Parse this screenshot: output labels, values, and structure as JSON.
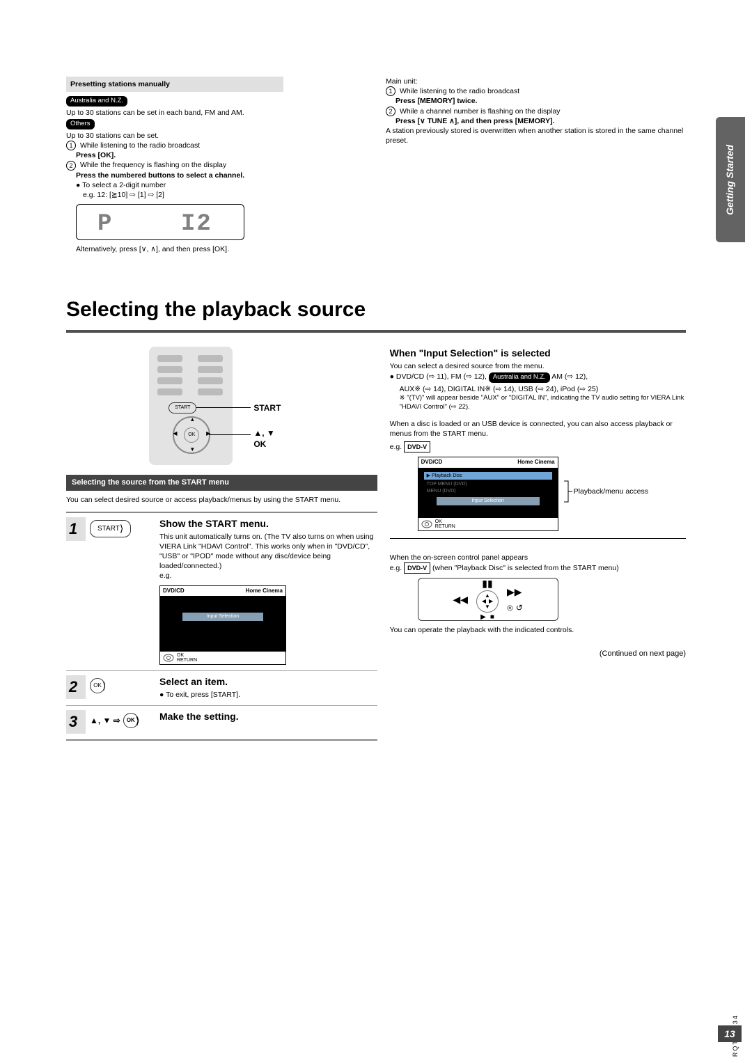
{
  "preset": {
    "title": "Presetting stations manually",
    "au_nz_tag": "Australia and N.Z.",
    "au_nz_text": "Up to 30 stations can be set in each band, FM and AM.",
    "others_tag": "Others",
    "others_text": "Up to 30 stations can be set.",
    "step1_pre": "While listening to the radio broadcast",
    "step1_bold": "Press [OK].",
    "step2_pre": "While the frequency is flashing on the display",
    "step2_bold": "Press the numbered buttons to select a channel.",
    "bullet2a": "To select a 2-digit number",
    "bullet2b": "e.g. 12: [≧10] ⇨ [1] ⇨ [2]",
    "seg_p": "P",
    "seg_12": "I2",
    "alt_text": "Alternatively, press [∨, ∧], and then press [OK]."
  },
  "mainunit": {
    "head": "Main unit:",
    "s1a": "While listening to the radio broadcast",
    "s1b": "Press [MEMORY] twice.",
    "s2a": "While a channel number is flashing on the display",
    "s2b": "Press [∨ TUNE ∧], and then press [MEMORY].",
    "note": "A station previously stored is overwritten when another station is stored in the same channel preset."
  },
  "heading": "Selecting the playback source",
  "remote_labels": {
    "start": "START",
    "arrows_ok": "▲, ▼\nOK",
    "start_btn": "START",
    "ok_btn": "OK"
  },
  "darkbar": "Selecting the source from the START menu",
  "darkbar_sub": "You can select desired source or access playback/menus by using the START menu.",
  "steps": {
    "s1": {
      "num": "1",
      "title": "Show the START menu.",
      "body": "This unit automatically turns on. (The TV also turns on when using VIERA Link \"HDAVI Control\". This works only when in \"DVD/CD\", \"USB\" or \"IPOD\" mode without any disc/device being loaded/connected.)",
      "eg": "e.g.",
      "screen_head_l": "DVD/CD",
      "screen_head_r": "Home Cinema",
      "screen_sel": "Input Selection",
      "okret": "OK\nRETURN",
      "start_btn": "START"
    },
    "s2": {
      "num": "2",
      "title": "Select an item.",
      "body": "● To exit, press [START].",
      "ok_btn": "OK"
    },
    "s3": {
      "num": "3",
      "title": "Make the setting.",
      "arrows": "▲, ▼ ⇨",
      "ok_btn": "OK"
    }
  },
  "rightcol": {
    "h": "When \"Input Selection\" is selected",
    "l1": "You can select a desired source from the menu.",
    "l2a": "● DVD/CD (⇨ 11), FM (⇨ 12), ",
    "l2tag": "Australia and N.Z.",
    "l2b": " AM (⇨ 12),",
    "l3": "AUX※ (⇨ 14), DIGITAL IN※ (⇨ 14), USB (⇨ 24), iPod (⇨ 25)",
    "l4": "※ \"(TV)\" will appear beside \"AUX\" or \"DIGITAL IN\", indicating the TV audio setting for VIERA Link \"HDAVI Control\" (⇨ 22).",
    "disc": "When a disc is loaded or an USB device is connected, you can also access playback or menus from the START menu.",
    "eg": "e.g. ",
    "eg_box": "DVD-V",
    "screen_head_l": "DVD/CD",
    "screen_head_r": "Home Cinema",
    "row1": "▶ Playback Disc",
    "row2": "TOP MENU (DVD)",
    "row3": "MENU (DVD)",
    "row4": "Input Selection",
    "okret": "OK\nRETURN",
    "annot": "Playback/menu access",
    "osd_intro": "When the on-screen control panel appears",
    "osd_eg": "e.g. ",
    "osd_box": "DVD-V",
    "osd_after": " (when \"Playback Disc\" is selected from the START menu)",
    "osd_note": "You can operate the playback with the indicated controls.",
    "cont": "(Continued on next page)"
  },
  "side_tab": "Getting Started",
  "pagenum": "13",
  "docid": "RQTX0234"
}
